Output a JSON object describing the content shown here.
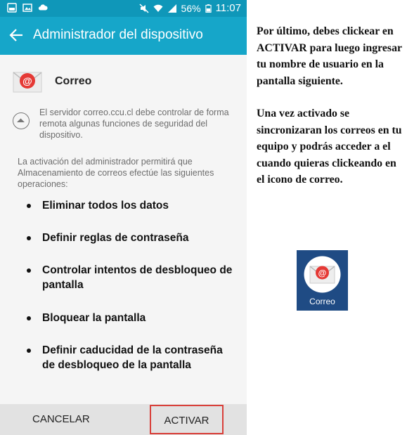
{
  "status_bar": {
    "battery_percent": "56%",
    "time": "11:07"
  },
  "app_bar": {
    "title": "Administrador del dispositivo"
  },
  "app": {
    "name": "Correo",
    "icon": "mail-app-icon"
  },
  "info": {
    "text": "El servidor correo.ccu.cl debe controlar de forma remota algunas funciones de seguridad del dispositivo."
  },
  "intro": "La activación del administrador permitirá que Almacenamiento de correos efectúe las siguientes operaciones:",
  "operations": [
    "Eliminar todos los datos",
    "Definir reglas de contraseña",
    "Controlar intentos de desbloqueo de pantalla",
    "Bloquear la pantalla",
    "Definir caducidad de la contraseña de desbloqueo de la pantalla"
  ],
  "buttons": {
    "cancel": "CANCELAR",
    "activate": "ACTIVAR"
  },
  "note": {
    "paragraph1": "Por último, debes clickear en ACTIVAR para luego ingresar tu nombre de usuario en la pantalla siguiente.",
    "paragraph2": "Una vez activado se sincronizaran los correos en tu equipo y podrás acceder a el cuando quieras clickeando en el icono de correo."
  },
  "launcher_icon": {
    "label": "Correo"
  },
  "colors": {
    "status_bar": "#0f97b9",
    "app_bar": "#16a6c9",
    "highlight": "#d9403a",
    "launcher_bg": "#1f4b84"
  }
}
